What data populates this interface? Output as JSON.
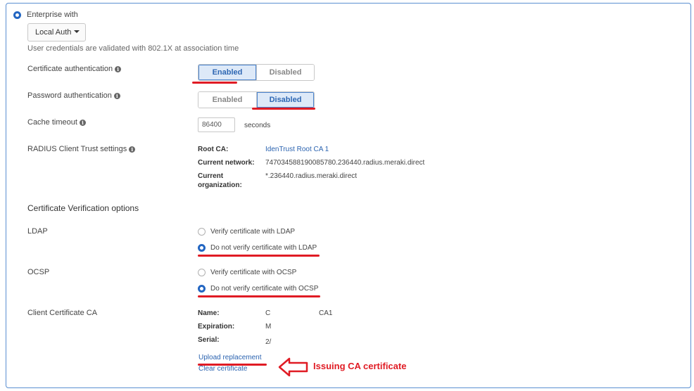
{
  "auth_mode": {
    "label": "Enterprise with",
    "dropdown_value": "Local Auth",
    "hint": "User credentials are validated with 802.1X at association time"
  },
  "certificate_auth": {
    "label": "Certificate authentication",
    "options": [
      "Enabled",
      "Disabled"
    ],
    "selected": "Enabled"
  },
  "password_auth": {
    "label": "Password authentication",
    "options": [
      "Enabled",
      "Disabled"
    ],
    "selected": "Disabled"
  },
  "cache_timeout": {
    "label": "Cache timeout",
    "value": "86400",
    "unit": "seconds"
  },
  "radius_trust": {
    "label": "RADIUS Client Trust settings",
    "root_ca_key": "Root CA:",
    "root_ca_value": "IdenTrust Root CA 1",
    "network_key": "Current network:",
    "network_value": "747034588190085780.236440.radius.meraki.direct",
    "org_key_line1": "Current",
    "org_key_line2": "organization:",
    "org_value": "*.236440.radius.meraki.direct"
  },
  "verification": {
    "title": "Certificate Verification options",
    "ldap": {
      "label": "LDAP",
      "opt_verify": "Verify certificate with LDAP",
      "opt_no_verify": "Do not verify certificate with LDAP",
      "selected": "no_verify"
    },
    "ocsp": {
      "label": "OCSP",
      "opt_verify": "Verify certificate with OCSP",
      "opt_no_verify": "Do not verify certificate with OCSP",
      "selected": "no_verify"
    }
  },
  "client_ca": {
    "label": "Client Certificate CA",
    "name_key": "Name:",
    "name_value_start": "C",
    "name_value_end": "CA1",
    "expiration_key": "Expiration:",
    "expiration_value": "M",
    "serial_key": "Serial:",
    "serial_value": "2/",
    "upload_link": "Upload replacement",
    "clear_link": "Clear certificate"
  },
  "annotation": {
    "text": "Issuing CA certificate",
    "color": "#e01b24"
  },
  "colors": {
    "accent": "#2366c2",
    "annotation_red": "#e01b24",
    "panel_border": "#5b8fd1"
  }
}
